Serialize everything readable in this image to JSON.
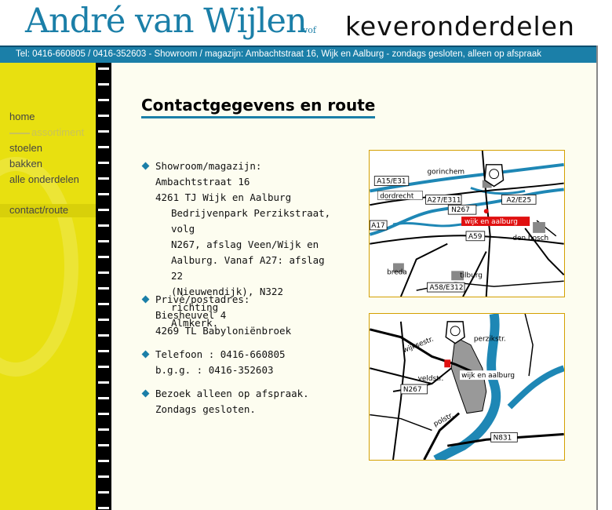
{
  "header": {
    "brand_name": "André van Wijlen",
    "brand_suffix": "vof",
    "tagline": "keveronderdelen"
  },
  "info_bar": {
    "text": "Tel: 0416-660805 / 0416-352603 - Showroom / magazijn: Ambachtstraat 16, Wijk en Aalburg - zondags gesloten, alleen op afspraak"
  },
  "nav": {
    "home": "home",
    "assortiment": "assortiment",
    "stoelen": "stoelen",
    "bakken": "bakken",
    "alle": "alle onderdelen",
    "contact": "contact/route"
  },
  "page": {
    "title": "Contactgegevens en route"
  },
  "showroom": {
    "label": "Showroom/magazijn:",
    "street": "Ambachtstraat 16",
    "city": "4261 TJ  Wijk en Aalburg",
    "directions": [
      "Bedrijvenpark Perzikstraat, volg",
      "N267, afslag Veen/Wijk en",
      "Aalburg. Vanaf A27: afslag 22",
      "(Nieuwendijk), N322 richting",
      "Almkerk."
    ]
  },
  "prive": {
    "label": "Privé/postadres:",
    "street": "Biesheuvel 4",
    "city": "4269 TL  Babyloniënbroek"
  },
  "telefoon": {
    "line1": "Telefoon : 0416-660805",
    "line2": "b.g.g. : 0416-352603"
  },
  "bezoek": {
    "line1": "Bezoek alleen op afspraak.",
    "line2": "Zondags gesloten."
  },
  "map_region": {
    "gorinchem": "gorinchem",
    "dordrecht": "dordrecht",
    "den_bosch": "den bosch",
    "breda": "breda",
    "tilburg": "tilburg",
    "wijk": "wijk en aalburg",
    "a15": "A15/E31",
    "a27": "A27/E311",
    "a2": "A2/E25",
    "n267": "N267",
    "a17": "A17",
    "a59": "A59",
    "a58": "A58/E312"
  },
  "map_local": {
    "perzik": "perzikstr.",
    "wijkses": "wijksestr.",
    "veld": "veldstr.",
    "wijk": "wijk en aalburg",
    "n267": "N267",
    "polstr": "polstr.",
    "n831": "N831"
  },
  "colors": {
    "accent": "#1b7fa8",
    "sidebar": "#e8e010",
    "map_water": "#1e87b5",
    "map_highlight": "#e01010"
  }
}
